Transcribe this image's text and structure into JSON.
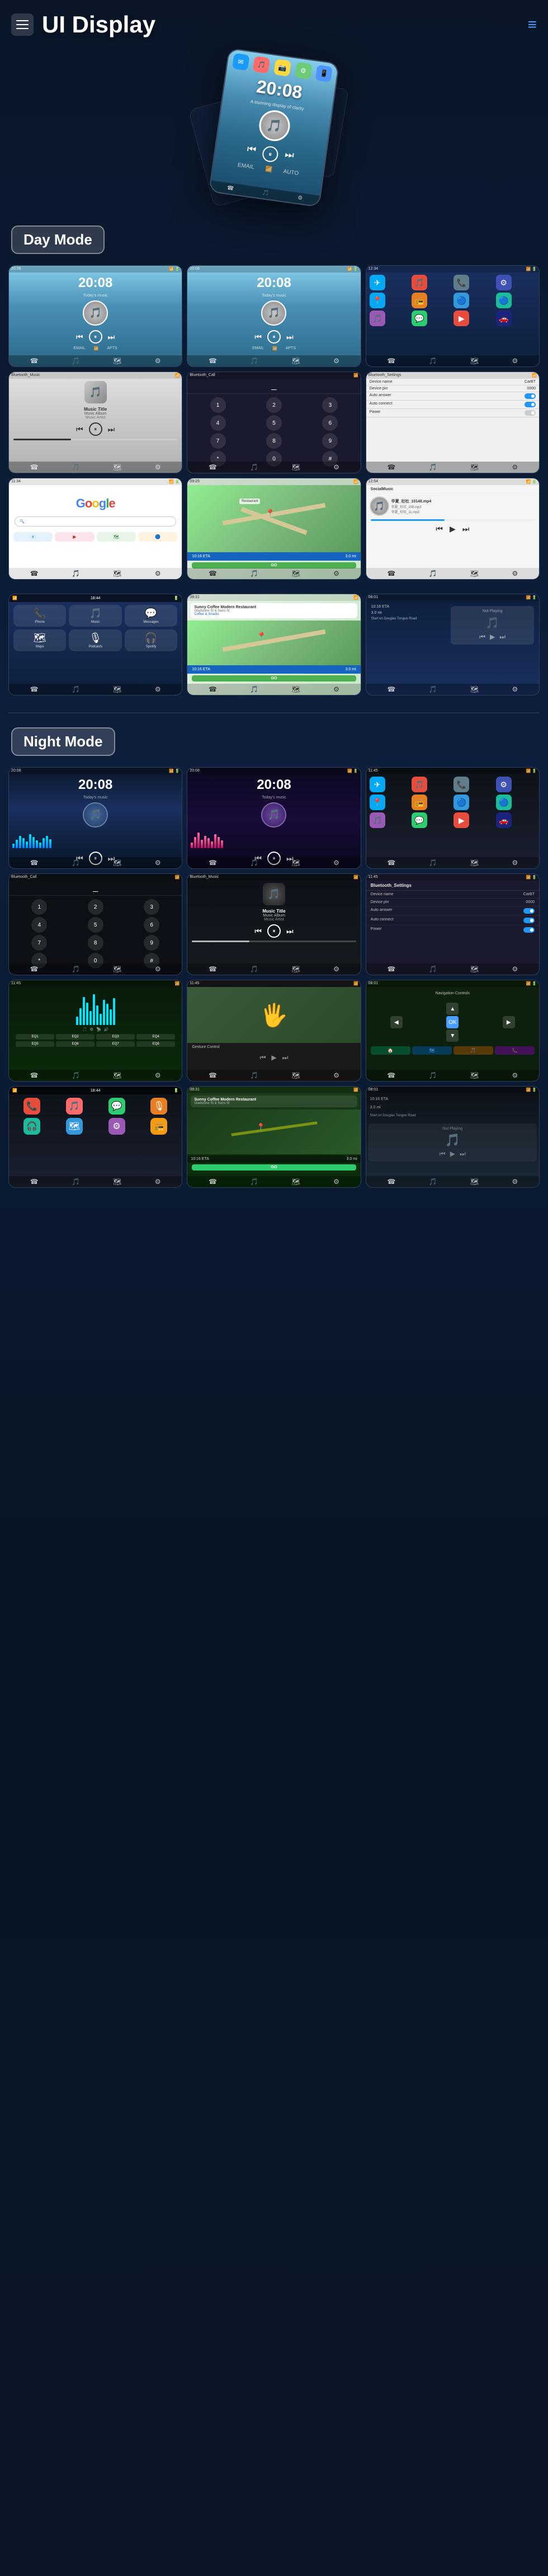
{
  "header": {
    "title": "UI Display",
    "menu_icon_label": "menu",
    "nav_icon_label": "≡"
  },
  "modes": {
    "day": "Day Mode",
    "night": "Night Mode"
  },
  "hero": {
    "time": "20:08",
    "subtitle": "A stunning display of clarity"
  },
  "day_screens": [
    {
      "id": "home1",
      "type": "home",
      "time": "20:08",
      "subtitle": "Today's music"
    },
    {
      "id": "home2",
      "type": "home",
      "time": "20:08",
      "subtitle": "Today's music"
    },
    {
      "id": "apps1",
      "type": "apps"
    },
    {
      "id": "music1",
      "type": "music",
      "title": "Music Title",
      "album": "Music Album",
      "artist": "Music Artist"
    },
    {
      "id": "phone1",
      "type": "phone"
    },
    {
      "id": "settings1",
      "type": "settings"
    },
    {
      "id": "google1",
      "type": "google"
    },
    {
      "id": "map1",
      "type": "map"
    },
    {
      "id": "social1",
      "type": "social"
    }
  ],
  "night_screens": [
    {
      "id": "nhome1",
      "type": "home_night",
      "time": "20:08"
    },
    {
      "id": "nhome2",
      "type": "home_night",
      "time": "20:08"
    },
    {
      "id": "napps1",
      "type": "apps_night"
    },
    {
      "id": "nphone1",
      "type": "phone_night"
    },
    {
      "id": "nmusic1",
      "type": "music_night",
      "title": "Music Title",
      "album": "Music Album",
      "artist": "Music Artist"
    },
    {
      "id": "nsettings1",
      "type": "settings_night"
    },
    {
      "id": "nwaveform1",
      "type": "waveform_night"
    },
    {
      "id": "nhand1",
      "type": "hand_night"
    },
    {
      "id": "nnav1",
      "type": "nav_night"
    },
    {
      "id": "ncarplay1",
      "type": "carplay_night"
    },
    {
      "id": "ncoffee1",
      "type": "coffee_night"
    },
    {
      "id": "nnotplaying1",
      "type": "notplaying_night"
    }
  ],
  "music": {
    "title": "Music Title",
    "album": "Music Album",
    "artist": "Music Artist",
    "track1": "华夏_社社_10148.mp4",
    "track2": "华夏_社社_208.mp3",
    "track3": "华夏_社社_11.mp3"
  },
  "settings": {
    "device_name_label": "Device name",
    "device_name_value": "CarBT",
    "device_pin_label": "Device pin",
    "device_pin_value": "0000",
    "auto_answer_label": "Auto answer",
    "auto_connect_label": "Auto connect",
    "power_label": "Power"
  },
  "navigation": {
    "eta": "10:16 ETA",
    "distance": "3.0 mi",
    "destination": "Start on Douglas Tongue Road",
    "go_label": "GO"
  },
  "coffee_shop": {
    "name": "Sunny Coffee Modern Restaurant",
    "address": "Gladstone St & Nuns St",
    "type": "Coffee & Snacks"
  },
  "colors": {
    "accent_blue": "#4a9eff",
    "day_blue": "#3498db",
    "night_bg": "#0a1628",
    "green": "#4caf50",
    "red": "#e74c3c"
  }
}
